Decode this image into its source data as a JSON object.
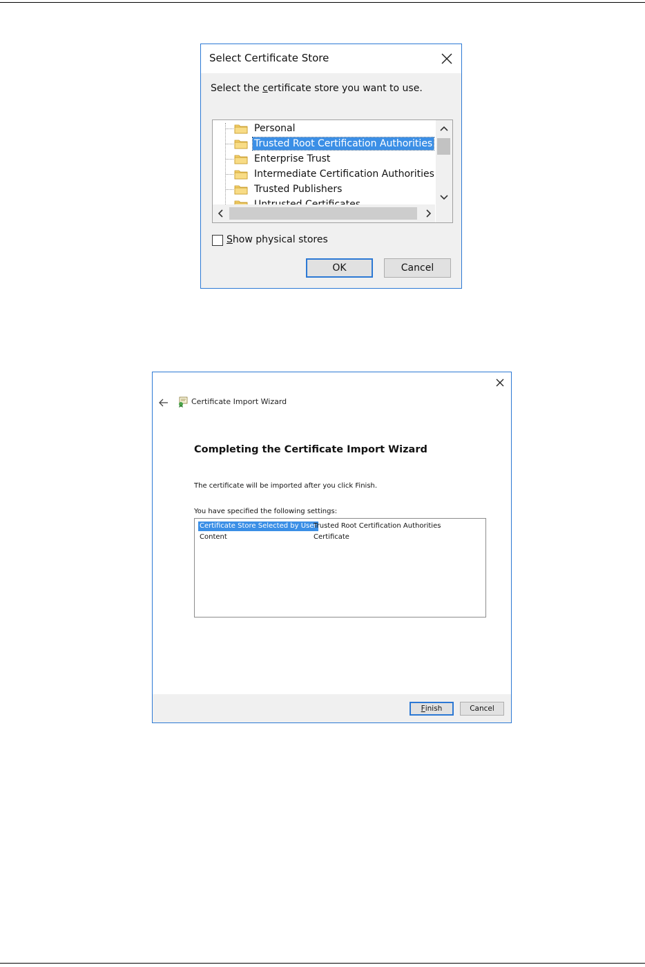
{
  "select_store_dialog": {
    "title": "Select Certificate Store",
    "prompt_before": "Select the ",
    "prompt_accel": "c",
    "prompt_after": "ertificate store you want to use.",
    "stores": [
      {
        "label": "Personal",
        "selected": false
      },
      {
        "label": "Trusted Root Certification Authorities",
        "selected": true
      },
      {
        "label": "Enterprise Trust",
        "selected": false
      },
      {
        "label": "Intermediate Certification Authorities",
        "selected": false
      },
      {
        "label": "Trusted Publishers",
        "selected": false
      },
      {
        "label": "Untrusted Certificates",
        "selected": false
      }
    ],
    "show_physical_stores": {
      "accel": "S",
      "label_rest": "how physical stores",
      "checked": false
    },
    "ok_label": "OK",
    "cancel_label": "Cancel"
  },
  "import_wizard": {
    "title": "Certificate Import Wizard",
    "heading": "Completing the Certificate Import Wizard",
    "info_text": "The certificate will be imported after you click Finish.",
    "settings_intro": "You have specified the following settings:",
    "settings": [
      {
        "key": "Certificate Store Selected by User",
        "value": "Trusted Root Certification Authorities",
        "selected": true
      },
      {
        "key": "Content",
        "value": "Certificate",
        "selected": false
      }
    ],
    "finish_accel": "F",
    "finish_rest": "inish",
    "cancel_label": "Cancel"
  },
  "colors": {
    "accent_border": "#2b78d4",
    "selection": "#3b8fe6",
    "dialog_bg": "#f0f0f0",
    "folder_yellow": "#f3cf6a"
  },
  "icons": [
    "close-icon",
    "folder-icon",
    "scroll-up-icon",
    "scroll-down-icon",
    "scroll-left-icon",
    "scroll-right-icon",
    "back-arrow-icon",
    "certificate-wizard-icon"
  ]
}
